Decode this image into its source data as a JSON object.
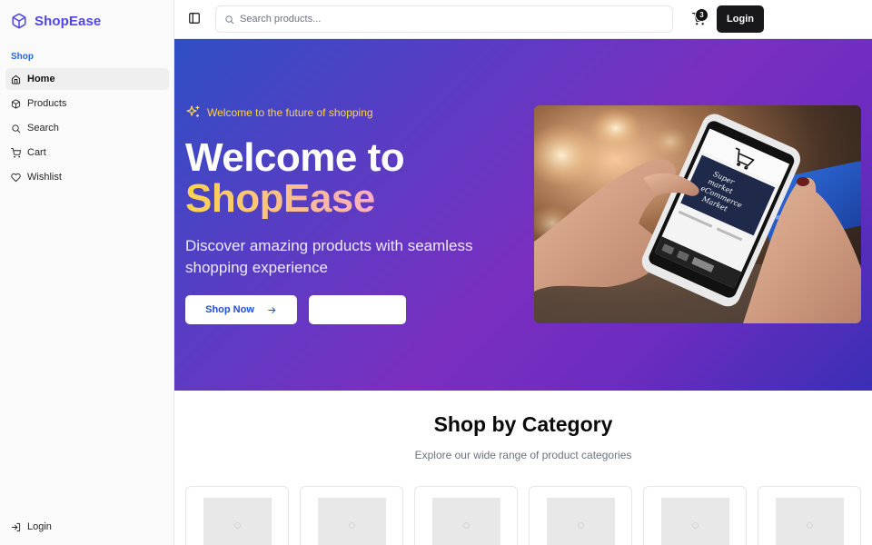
{
  "brand": {
    "name": "ShopEase",
    "icon": "package-icon",
    "color": "#4f46e5"
  },
  "sidebar": {
    "section_label": "Shop",
    "items": [
      {
        "label": "Home",
        "icon": "home-icon",
        "active": true
      },
      {
        "label": "Products",
        "icon": "box-icon",
        "active": false
      },
      {
        "label": "Search",
        "icon": "search-icon",
        "active": false
      },
      {
        "label": "Cart",
        "icon": "cart-icon",
        "active": false
      },
      {
        "label": "Wishlist",
        "icon": "heart-icon",
        "active": false
      }
    ],
    "footer_login": "Login"
  },
  "header": {
    "search_placeholder": "Search products...",
    "search_value": "",
    "cart_count": "3",
    "login_label": "Login"
  },
  "hero": {
    "tagline": "Welcome to the future of shopping",
    "title_line1": "Welcome to",
    "title_line2": "ShopEase",
    "subtitle": "Discover amazing products with seamless shopping experience",
    "primary_button": "Shop Now",
    "secondary_button": "",
    "image_text": [
      "Super",
      "market",
      "eCommerce",
      "Market"
    ]
  },
  "categories": {
    "title": "Shop by Category",
    "subtitle": "Explore our wide range of product categories",
    "count": 6
  },
  "colors": {
    "accent_blue": "#2563eb",
    "hero_gradient_start": "#2f4fc4",
    "hero_gradient_mid": "#7a2fc0",
    "tagline_yellow": "#fcd34d",
    "login_button": "#18181b"
  }
}
